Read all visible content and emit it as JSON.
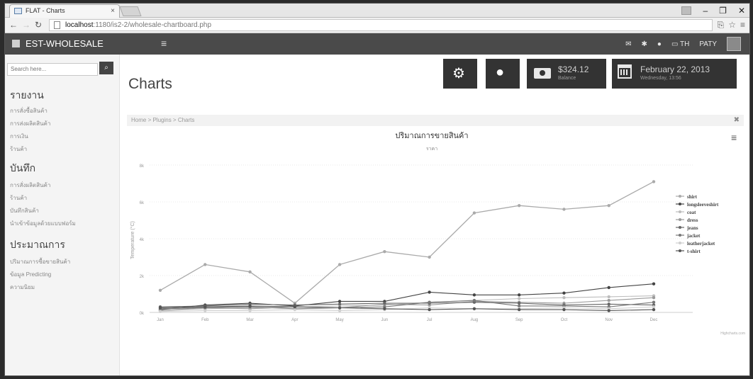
{
  "browser": {
    "tab_title": "FLAT - Charts",
    "tab_close": "×",
    "url_host": "localhost",
    "url_path": ":1180/is2-2/wholesale-chartboard.php",
    "win_controls": [
      "–",
      "❐",
      "✕"
    ]
  },
  "navbar": {
    "brand": "EST-WHOLESALE",
    "lang": "TH",
    "user": "PATY",
    "icons": [
      "mail-icon",
      "gear-icon",
      "drop-icon",
      "flag-icon"
    ]
  },
  "sidebar": {
    "search_placeholder": "Search here...",
    "sections": [
      {
        "title": "รายงาน",
        "items": [
          "การสั่งซื้อสินค้า",
          "การส่งผลิตสินค้า",
          "การเงิน",
          "ร้านค้า"
        ]
      },
      {
        "title": "บันทึก",
        "items": [
          "การสั่งผลิตสินค้า",
          "ร้านค้า",
          "บันทึกสินค้า",
          "นำเข้าข้อมูลด้วยแบบฟอร์ม"
        ]
      },
      {
        "title": "ประมาณการ",
        "items": [
          "ปริมาณการซื้อขายสินค้า",
          "ข้อมูล Predicting",
          "ความนิยม"
        ]
      }
    ]
  },
  "main": {
    "page_title": "Charts",
    "balance_amount": "$324.12",
    "balance_label": "Balance",
    "date_main": "February 22, 2013",
    "date_sub": "Wednesday, 13:56",
    "breadcrumb": "Home > Plugins > Charts",
    "breadcrumb_close": "✖",
    "chart_menu": "≡",
    "credits": "Highcharts.com"
  },
  "colors": {
    "navbar": "#4a4a4a",
    "tile": "#333333",
    "shirt": "#aaaaaa",
    "longsleeveshirt": "#444444"
  },
  "chart_data": {
    "type": "line",
    "title": "ปริมาณการขายสินค้า",
    "subtitle": "ราคา",
    "xlabel": "",
    "ylabel": "Temperature (°C)",
    "categories": [
      "Jan",
      "Feb",
      "Mar",
      "Apr",
      "May",
      "Jun",
      "Jul",
      "Aug",
      "Sep",
      "Oct",
      "Nov",
      "Dec"
    ],
    "yticks": [
      "0k",
      "2k",
      "4k",
      "6k",
      "8k"
    ],
    "ylim": [
      0,
      8000
    ],
    "grid": true,
    "legend": "right",
    "series": [
      {
        "name": "shirt",
        "values": [
          1200,
          2600,
          2200,
          500,
          2600,
          3300,
          3000,
          5400,
          5800,
          5600,
          5800,
          7100
        ]
      },
      {
        "name": "longsleeveshirt",
        "values": [
          150,
          400,
          500,
          350,
          600,
          600,
          1100,
          950,
          950,
          1050,
          1350,
          1550
        ]
      },
      {
        "name": "coat",
        "values": [
          100,
          200,
          250,
          300,
          350,
          400,
          550,
          650,
          750,
          800,
          850,
          900
        ]
      },
      {
        "name": "dress",
        "values": [
          100,
          250,
          200,
          300,
          250,
          450,
          400,
          600,
          550,
          500,
          650,
          800
        ]
      },
      {
        "name": "jeans",
        "values": [
          300,
          350,
          450,
          400,
          450,
          500,
          500,
          550,
          500,
          400,
          450,
          400
        ]
      },
      {
        "name": "jacket",
        "values": [
          200,
          250,
          300,
          200,
          250,
          300,
          550,
          650,
          350,
          350,
          300,
          550
        ]
      },
      {
        "name": "leatherjacket",
        "values": [
          50,
          100,
          100,
          150,
          100,
          150,
          250,
          200,
          200,
          250,
          200,
          300
        ]
      },
      {
        "name": "t-shirt",
        "values": [
          250,
          300,
          350,
          300,
          250,
          200,
          150,
          200,
          150,
          150,
          100,
          150
        ]
      }
    ]
  }
}
